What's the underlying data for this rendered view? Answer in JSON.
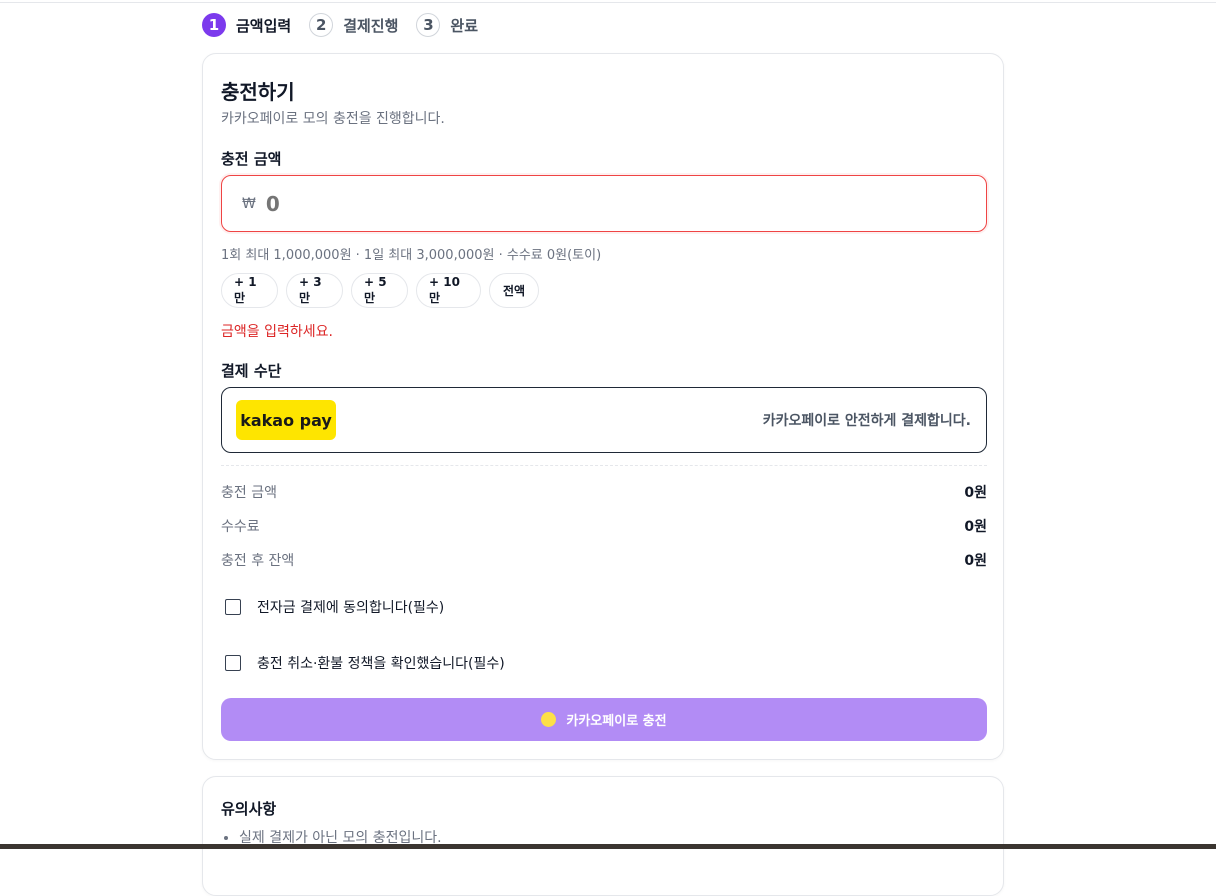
{
  "stepper": {
    "steps": [
      {
        "num": "1",
        "label": "금액입력",
        "active": true
      },
      {
        "num": "2",
        "label": "결제진행",
        "active": false
      },
      {
        "num": "3",
        "label": "완료",
        "active": false
      }
    ]
  },
  "charge": {
    "title": "충전하기",
    "subtitle": "카카오페이로 모의 충전을 진행합니다.",
    "amount_label": "충전 금액",
    "currency_symbol": "₩",
    "amount_placeholder": "0",
    "amount_value": "",
    "limit_text": "1회 최대 1,000,000원 · 1일 최대 3,000,000원 · 수수료 0원(토이)",
    "quick_add": [
      "+ 1만",
      "+ 3만",
      "+ 5만",
      "+ 10만",
      "전액"
    ],
    "error_text": "금액을 입력하세요.",
    "payment_label": "결제 수단",
    "payment_method": {
      "logo_text": "kakao pay",
      "description": "카카오페이로 안전하게 결제합니다.",
      "brand_color": "#FEE500"
    },
    "summary": [
      {
        "label": "충전 금액",
        "value": "0원"
      },
      {
        "label": "수수료",
        "value": "0원"
      },
      {
        "label": "충전 후 잔액",
        "value": "0원"
      }
    ],
    "agreements": [
      {
        "label": "전자금 결제에 동의합니다(필수)",
        "checked": false
      },
      {
        "label": "충전 취소·환불 정책을 확인했습니다(필수)",
        "checked": false
      }
    ],
    "submit_label": "카카오페이로 충전"
  },
  "notice": {
    "title": "유의사항",
    "items": [
      "실제 결제가 아닌 모의 충전입니다."
    ]
  },
  "colors": {
    "accent": "#7C3AED",
    "submit_disabled": "#B28CF5",
    "error": "#DC2626",
    "input_error_border": "#EF4444"
  }
}
